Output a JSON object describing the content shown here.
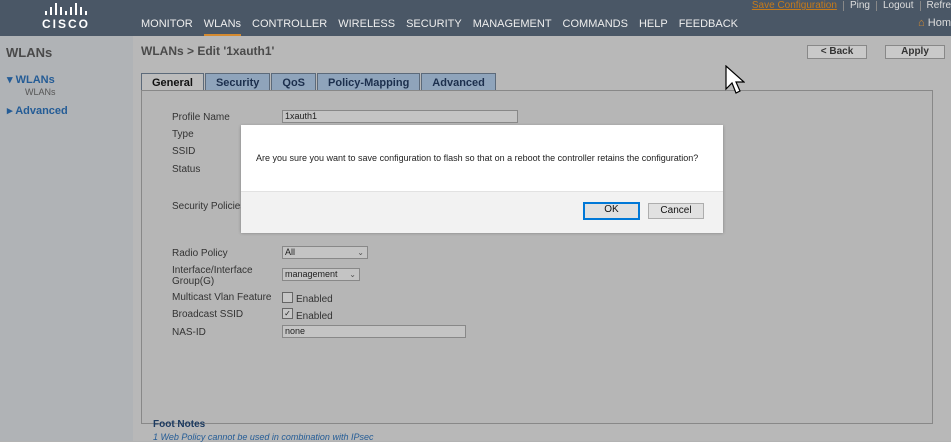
{
  "header": {
    "brand": "CISCO",
    "utility_links": [
      "Save Configuration",
      "Ping",
      "Logout",
      "Refre"
    ],
    "menu": [
      "MONITOR",
      "WLANs",
      "CONTROLLER",
      "WIRELESS",
      "SECURITY",
      "MANAGEMENT",
      "COMMANDS",
      "HELP",
      "FEEDBACK"
    ],
    "active_menu": "WLANs",
    "home_label": "Hom"
  },
  "sidebar": {
    "title": "WLANs",
    "groups": [
      {
        "label": "WLANs",
        "expanded": true,
        "children": [
          "WLANs"
        ]
      },
      {
        "label": "Advanced",
        "expanded": false
      }
    ]
  },
  "page": {
    "title": "WLANs > Edit   '1xauth1'",
    "back_label": "< Back",
    "apply_label": "Apply",
    "tabs": [
      "General",
      "Security",
      "QoS",
      "Policy-Mapping",
      "Advanced"
    ],
    "active_tab": "General"
  },
  "form": {
    "profile_name_label": "Profile Name",
    "profile_name_value": "1xauth1",
    "type_label": "Type",
    "ssid_label": "SSID",
    "status_label": "Status",
    "security_policies_label": "Security Policies",
    "radio_policy_label": "Radio Policy",
    "radio_policy_value": "All",
    "interface_label_line1": "Interface/Interface",
    "interface_label_line2": "Group(G)",
    "interface_value": "management",
    "multicast_label": "Multicast Vlan Feature",
    "multicast_option": "Enabled",
    "multicast_checked": false,
    "broadcast_label": "Broadcast SSID",
    "broadcast_option": "Enabled",
    "broadcast_checked": true,
    "nas_id_label": "NAS-ID",
    "nas_id_value": "none"
  },
  "footnotes": {
    "title": "Foot Notes",
    "line1": "1 Web Policy cannot be used in combination with IPsec"
  },
  "dialog": {
    "message": "Are you sure you want to save configuration to flash so that on a reboot the controller retains the configuration?",
    "ok_label": "OK",
    "cancel_label": "Cancel"
  },
  "colors": {
    "header_bg": "#4a5766",
    "accent": "#d48a30",
    "tab_bg": "#8fa4bb",
    "dialog_button_focus": "#0078d7"
  },
  "icons": [
    "cisco-logo",
    "expand-arrow-icon",
    "collapse-arrow-icon",
    "home-icon",
    "mouse-cursor-icon",
    "dropdown-chevron-icon",
    "checkmark-icon"
  ]
}
